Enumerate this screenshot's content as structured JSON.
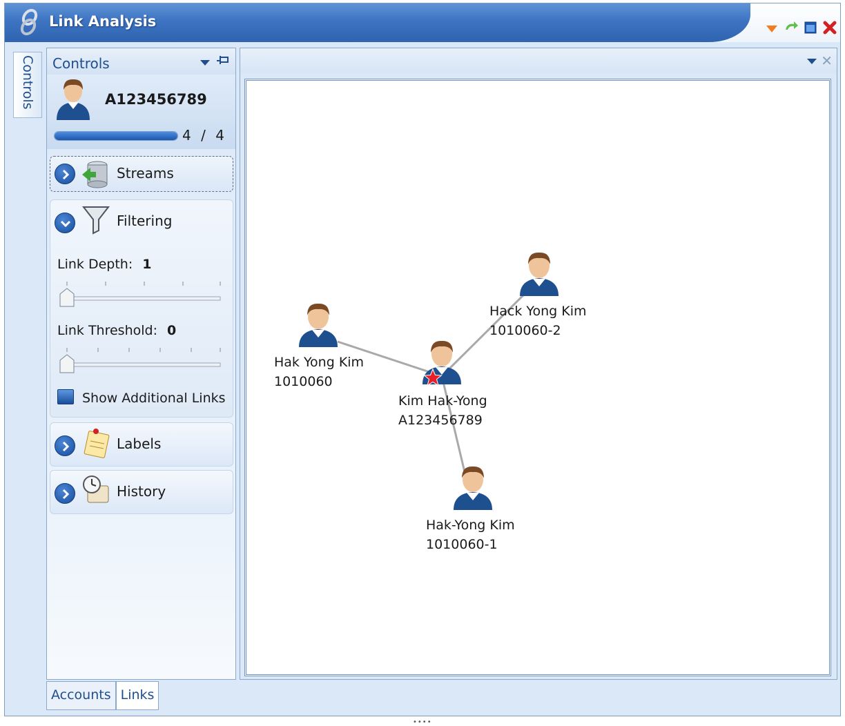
{
  "window": {
    "title": "Link Analysis"
  },
  "left_strip": {
    "label": "Controls"
  },
  "controls_panel": {
    "title": "Controls",
    "account_id": "A123456789",
    "progress": {
      "current": "4",
      "separator": "/",
      "total": "4",
      "fraction": 1.0
    },
    "sections": {
      "streams": {
        "label": "Streams"
      },
      "filtering": {
        "label": "Filtering",
        "link_depth": {
          "label": "Link Depth:",
          "value": "1"
        },
        "link_threshold": {
          "label": "Link Threshold:",
          "value": "0"
        },
        "show_additional_links": {
          "label": "Show Additional Links"
        }
      },
      "labels": {
        "label": "Labels"
      },
      "history": {
        "label": "History"
      }
    }
  },
  "bottom_tabs": [
    {
      "label": "Accounts"
    },
    {
      "label": "Links"
    }
  ],
  "graph": {
    "nodes": [
      {
        "name": "Kim Hak-Yong",
        "id": "A123456789",
        "center": true
      },
      {
        "name": "Hak Yong  Kim",
        "id": "1010060"
      },
      {
        "name": "Hack Yong  Kim",
        "id": "1010060-2"
      },
      {
        "name": "Hak-Yong  Kim",
        "id": "1010060-1"
      }
    ]
  },
  "colors": {
    "title_blue": "#3d74c2",
    "accent_blue": "#1b57ad",
    "star_red": "#e8202a",
    "edge_gray": "#a9a9a9"
  },
  "icons": [
    "app-link-icon",
    "dropdown-icon",
    "pin-icon",
    "user-avatar-icon",
    "database-icon",
    "funnel-icon",
    "notepad-icon",
    "clock-scroll-icon",
    "close-icon",
    "star-icon",
    "chevron-right-icon",
    "chevron-down-icon"
  ]
}
